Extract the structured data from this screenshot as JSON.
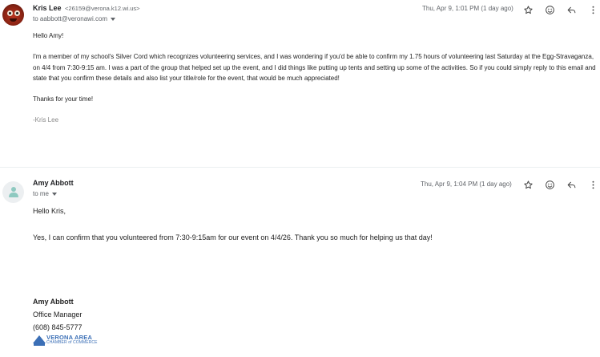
{
  "messages": [
    {
      "sender_name": "Kris Lee",
      "sender_email": "<26159@verona.k12.wi.us>",
      "to": "to aabbott@veronawi.com",
      "date": "Thu, Apr 9, 1:01 PM (1 day ago)",
      "greeting": "Hello Amy!",
      "paragraph": "I'm a member of my school's Silver Cord which recognizes volunteering services, and I was wondering if you'd be able to confirm my 1.75 hours of volunteering last Saturday at the Egg-Stravaganza, on 4/4 from 7:30-9:15 am. I was a part of the group that helped set up the event, and I did things like putting up tents and setting up some of the activities. So if you could simply reply to this email and state that you confirm these details and also list your title/role for the event, that would be much appreciated!",
      "closing": "Thanks for your time!",
      "signoff": "-Kris Lee"
    },
    {
      "sender_name": "Amy Abbott",
      "to": "to me",
      "date": "Thu, Apr 9, 1:04 PM (1 day ago)",
      "greeting": "Hello Kris,",
      "paragraph": "Yes, I can confirm that you volunteered from 7:30-9:15am for our event on 4/4/26.  Thank you so much for helping us that day!",
      "signature": {
        "name": "Amy Abbott",
        "title": "Office Manager",
        "phone": "(608) 845-5777",
        "logo_line1": "VERONA AREA",
        "logo_line2": "CHAMBER of COMMERCE",
        "logo_mark": "VACC"
      }
    }
  ],
  "actions": [
    "star-icon",
    "emoji-icon",
    "reply-icon",
    "more-vert-icon"
  ],
  "colors": {
    "muted": "#5f6368",
    "logo_blue": "#3b6fb6",
    "avatar_placeholder": "#8ec9c0"
  }
}
